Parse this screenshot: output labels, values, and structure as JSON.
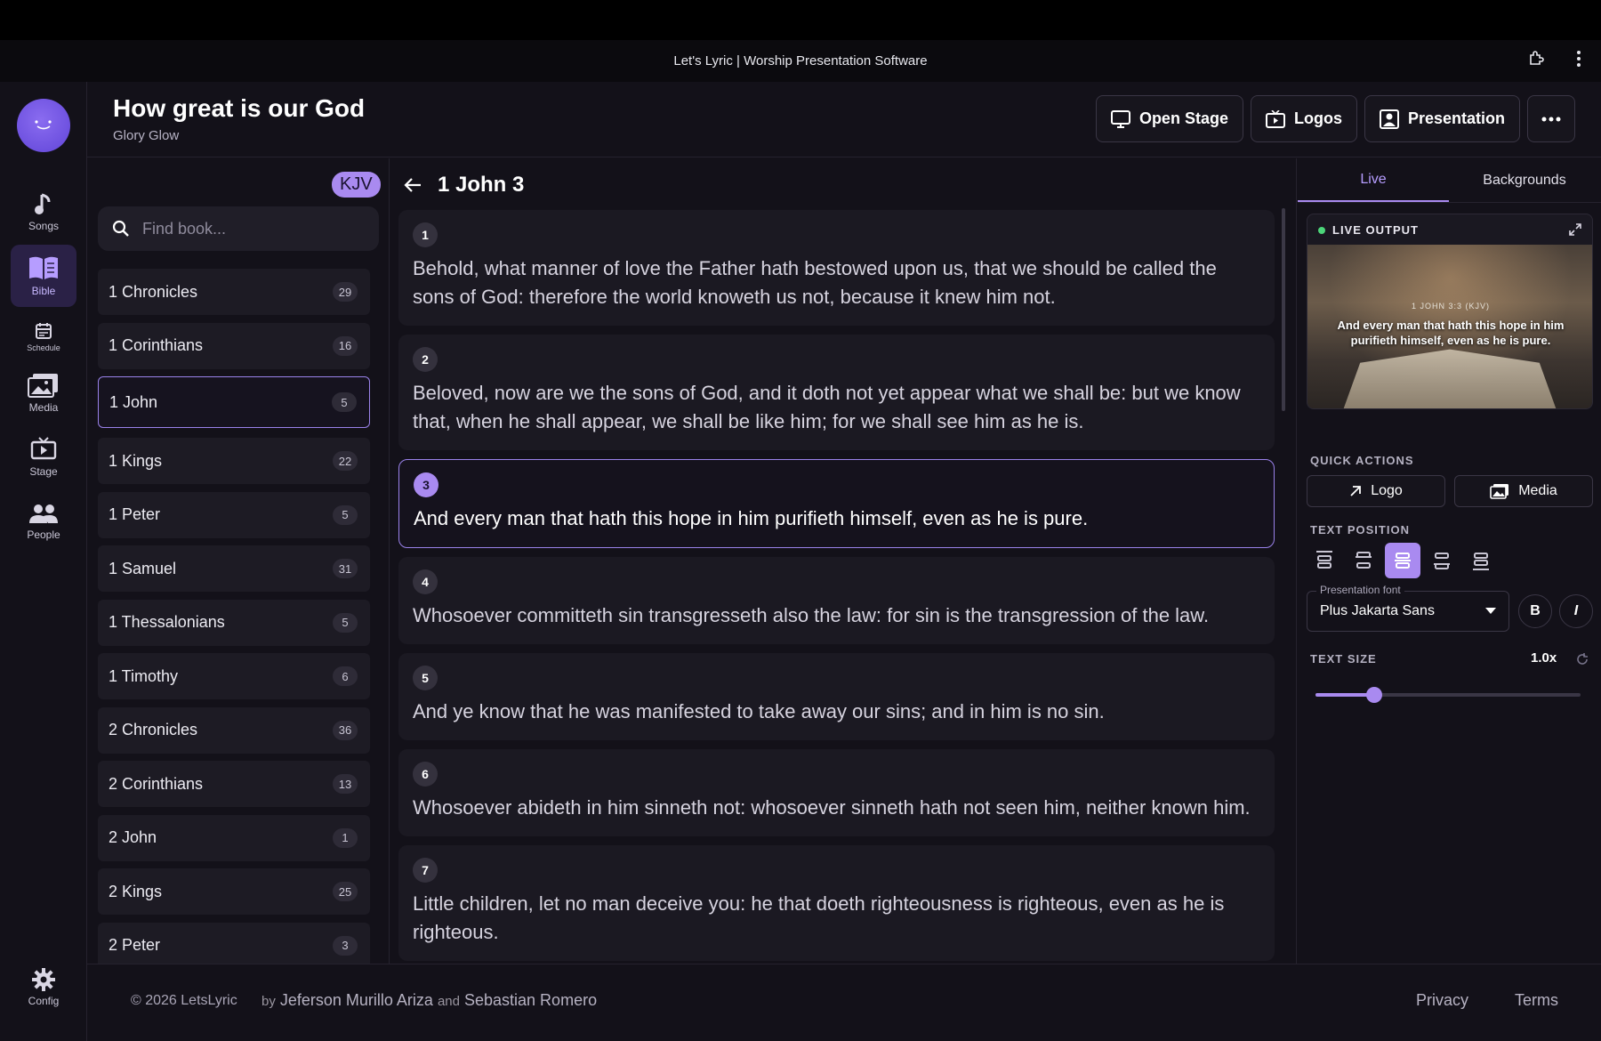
{
  "window": {
    "title": "Let's Lyric | Worship Presentation Software"
  },
  "nav": {
    "items": [
      {
        "label": "Songs",
        "icon": "music-note-icon"
      },
      {
        "label": "Bible",
        "icon": "book-open-icon",
        "active": true
      },
      {
        "label": "Schedule",
        "icon": "calendar-icon"
      },
      {
        "label": "Media",
        "icon": "images-icon"
      },
      {
        "label": "Stage",
        "icon": "tv-icon"
      },
      {
        "label": "People",
        "icon": "people-icon"
      }
    ],
    "config_label": "Config"
  },
  "header": {
    "title": "How great is our God",
    "subtitle": "Glory Glow",
    "buttons": {
      "open_stage": "Open Stage",
      "logos": "Logos",
      "presentation": "Presentation"
    }
  },
  "books": {
    "version": "KJV",
    "search_placeholder": "Find book...",
    "items": [
      {
        "name": "1 Chronicles",
        "count": "29"
      },
      {
        "name": "1 Corinthians",
        "count": "16"
      },
      {
        "name": "1 John",
        "count": "5",
        "active": true
      },
      {
        "name": "1 Kings",
        "count": "22"
      },
      {
        "name": "1 Peter",
        "count": "5"
      },
      {
        "name": "1 Samuel",
        "count": "31"
      },
      {
        "name": "1 Thessalonians",
        "count": "5"
      },
      {
        "name": "1 Timothy",
        "count": "6"
      },
      {
        "name": "2 Chronicles",
        "count": "36"
      },
      {
        "name": "2 Corinthians",
        "count": "13"
      },
      {
        "name": "2 John",
        "count": "1"
      },
      {
        "name": "2 Kings",
        "count": "25"
      },
      {
        "name": "2 Peter",
        "count": "3"
      }
    ]
  },
  "chapter": {
    "title": "1 John 3",
    "verses": [
      {
        "num": "1",
        "text": "Behold, what manner of love the Father hath bestowed upon us, that we should be called the sons of God: therefore the world knoweth us not, because it knew him not."
      },
      {
        "num": "2",
        "text": "Beloved, now are we the sons of God, and it doth not yet appear what we shall be: but we know that, when he shall appear, we shall be like him; for we shall see him as he is."
      },
      {
        "num": "3",
        "text": "And every man that hath this hope in him purifieth himself, even as he is pure.",
        "active": true
      },
      {
        "num": "4",
        "text": "Whosoever committeth sin transgresseth also the law: for sin is the transgression of the law."
      },
      {
        "num": "5",
        "text": "And ye know that he was manifested to take away our sins; and in him is no sin."
      },
      {
        "num": "6",
        "text": "Whosoever abideth in him sinneth not: whosoever sinneth hath not seen him, neither known him."
      },
      {
        "num": "7",
        "text": "Little children, let no man deceive you: he that doeth righteousness is righteous, even as he is righteous."
      }
    ]
  },
  "right": {
    "tabs": [
      "Live",
      "Backgrounds"
    ],
    "live_label": "LIVE OUTPUT",
    "live_ref": "1 JOHN 3:3 (KJV)",
    "live_text": "And every man that hath this hope in him purifieth himself, even as he is pure.",
    "quick_actions_label": "QUICK ACTIONS",
    "qa_logo": "Logo",
    "qa_media": "Media",
    "text_position_label": "TEXT POSITION",
    "font_label": "Presentation font",
    "font_value": "Plus Jakarta Sans",
    "bold": "B",
    "italic": "I",
    "text_size_label": "TEXT SIZE",
    "text_size_value": "1.0x",
    "text_size_fraction": 0.22,
    "accent_color": "#a98af0"
  },
  "footer": {
    "copyright": "© 2026 LetsLyric",
    "by": "by",
    "author1": "Jeferson Murillo Ariza",
    "and": "and",
    "author2": "Sebastian Romero",
    "privacy": "Privacy",
    "terms": "Terms"
  }
}
